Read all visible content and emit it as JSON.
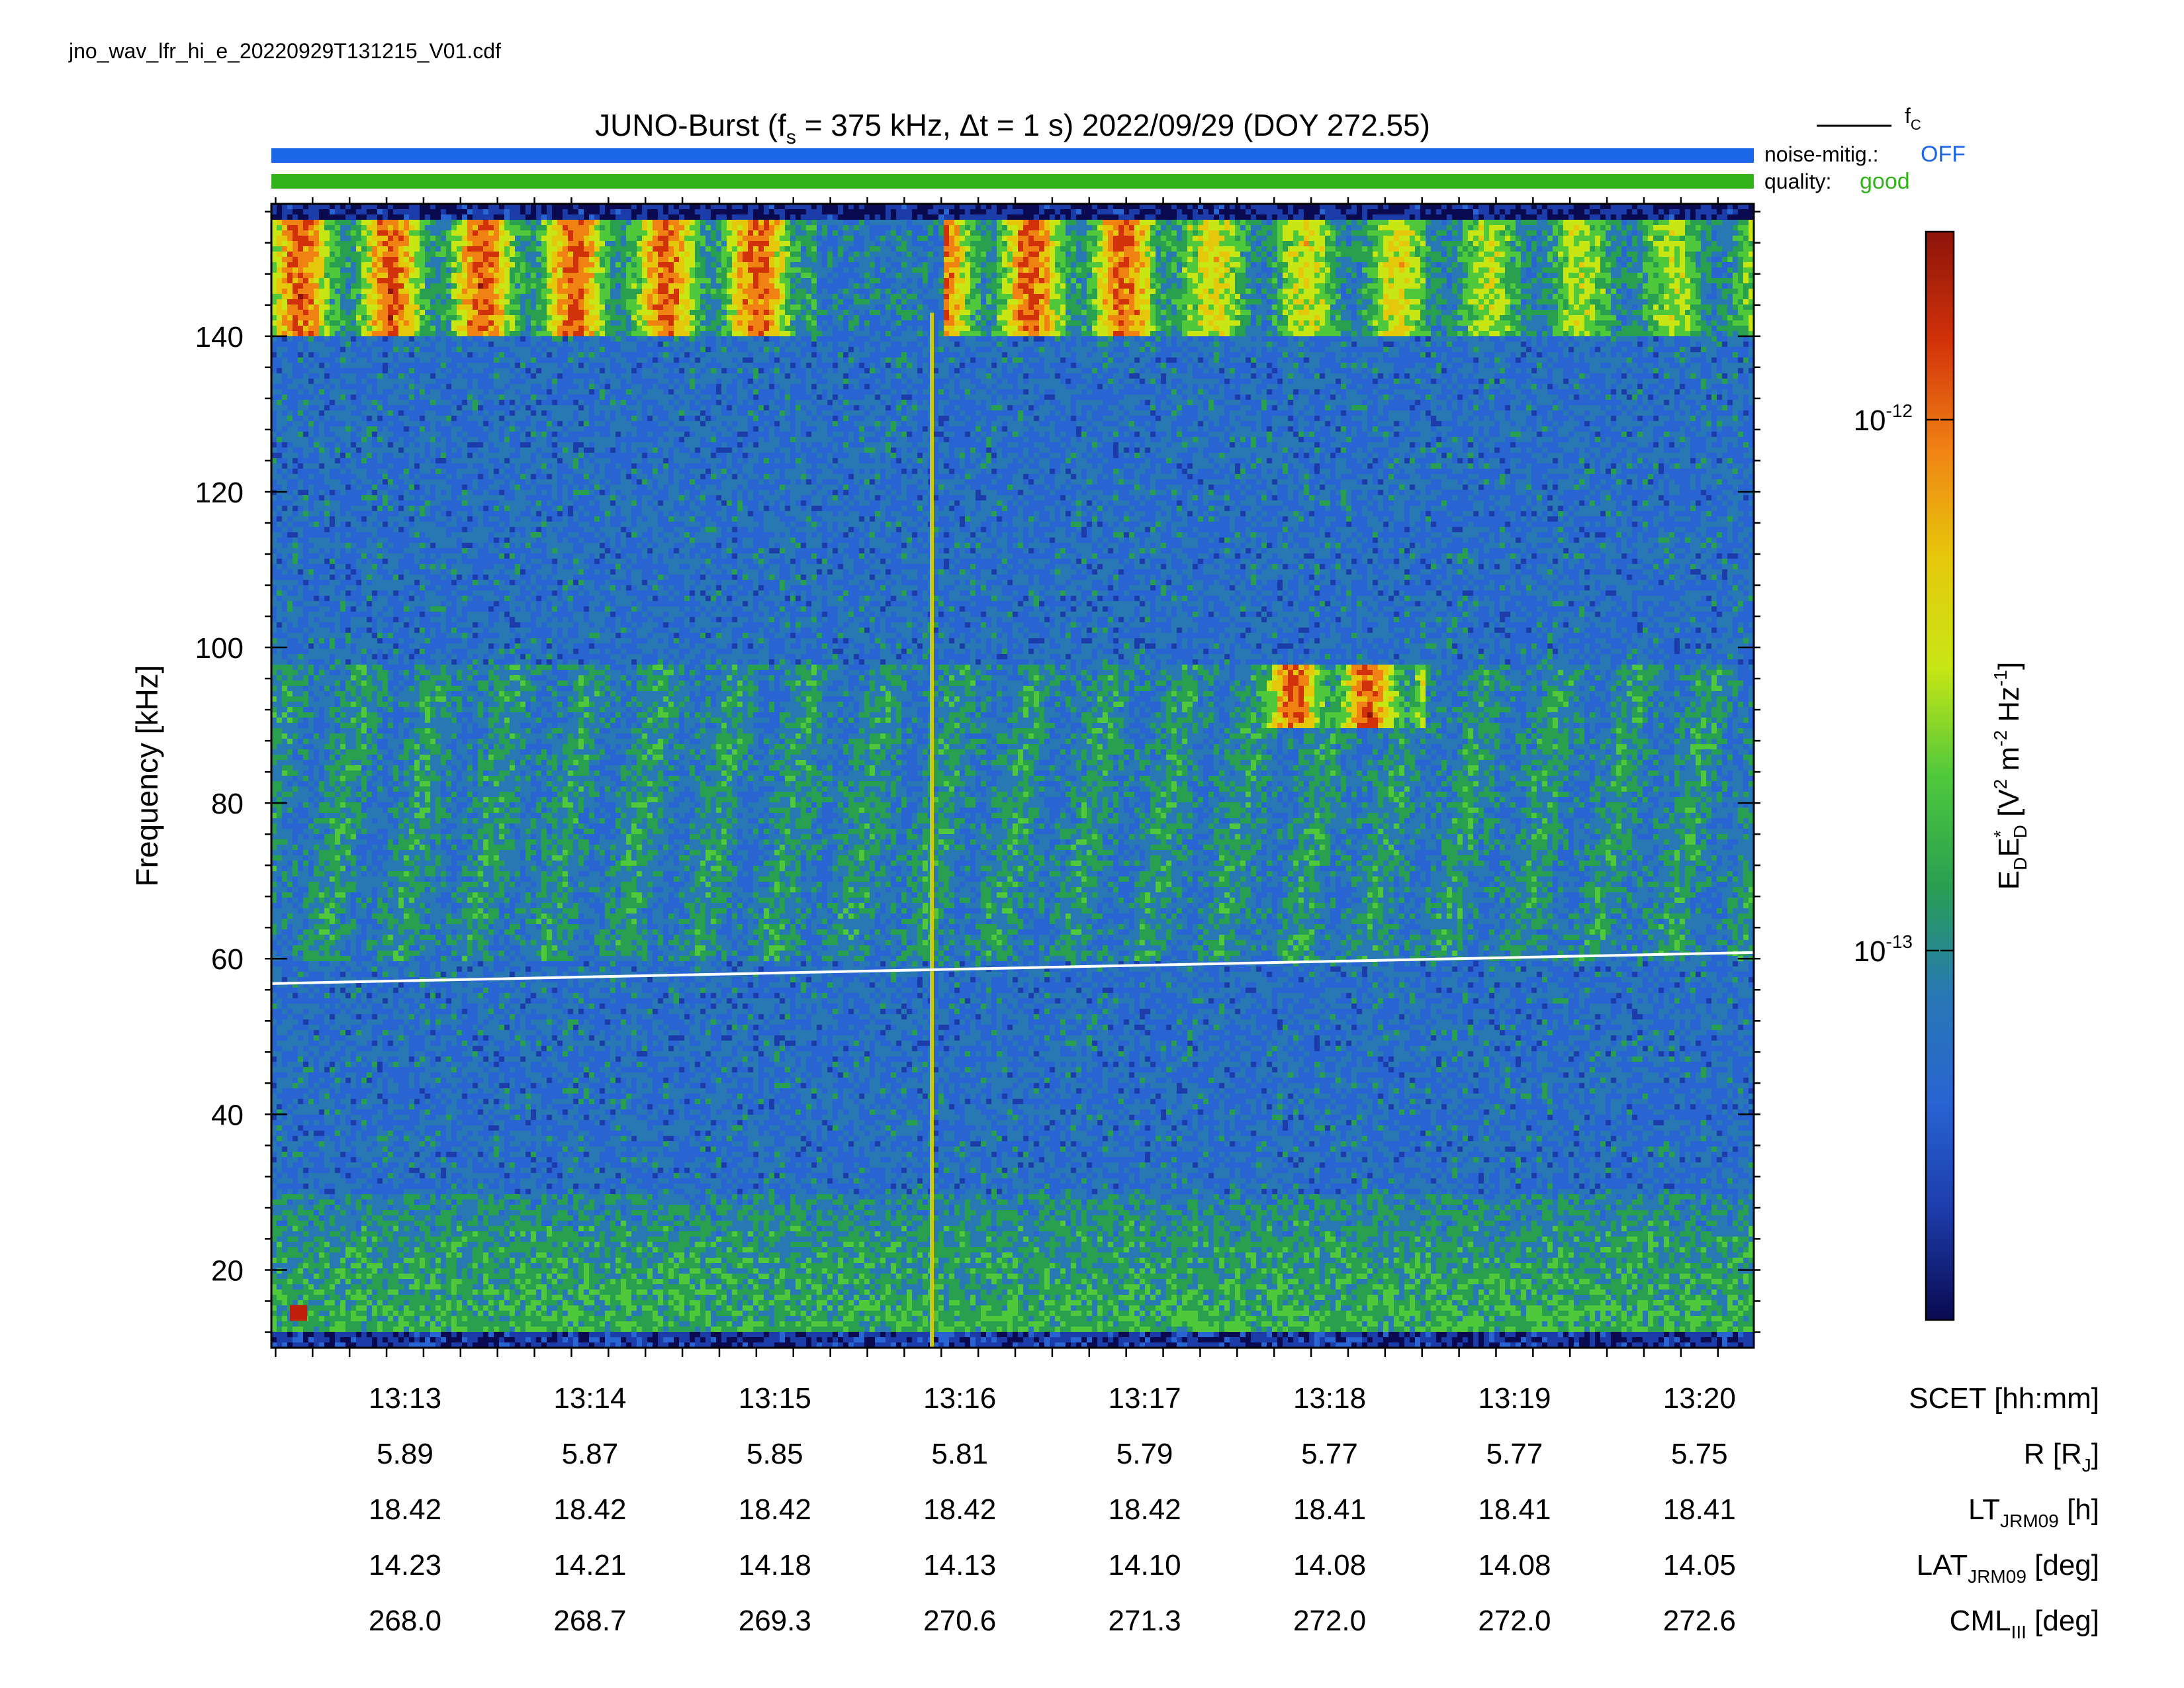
{
  "filename": "jno_wav_lfr_hi_e_20220929T131215_V01.cdf",
  "title": {
    "prefix": "JUNO-Burst (f",
    "fs_sub": "s",
    "mid": " = 375 kHz, Δt = 1 s)  2022/09/29 (DOY 272.55)"
  },
  "legend": {
    "fc_label": "f",
    "fc_sub": "C",
    "noise_label": "noise-mitig.:",
    "noise_value": "OFF",
    "quality_label": "quality:",
    "quality_value": "good",
    "noise_color": "#1a66e6",
    "quality_color": "#33b31a"
  },
  "colorbar": {
    "label_main": "E",
    "label_sub1": "D",
    "label_E2": "E",
    "label_sup": "*",
    "label_sub2": "D",
    "label_units_pre": " [V",
    "label_sup2": "2",
    "label_units_mid": " m",
    "label_sup3": "-2",
    "label_units_hz": " Hz",
    "label_sup4": "-1",
    "label_units_end": "]",
    "tick_base": "10",
    "ticks": [
      {
        "exp": "-12"
      },
      {
        "exp": "-13"
      }
    ],
    "colormap": [
      "#0a0a50",
      "#1c3caa",
      "#2864d2",
      "#2878b4",
      "#28a050",
      "#50c83c",
      "#c8e614",
      "#e6c80a",
      "#f08214",
      "#d2320a",
      "#8c140a"
    ]
  },
  "chart_data": {
    "type": "heatmap",
    "ylabel": "Frequency [kHz]",
    "ylim": [
      10,
      157
    ],
    "yticks": [
      "20",
      "40",
      "60",
      "80",
      "100",
      "120",
      "140"
    ],
    "ytick_values": [
      20,
      40,
      60,
      80,
      100,
      120,
      140
    ],
    "x_rows": [
      {
        "label": "SCET [hh:mm]",
        "values": [
          "13:13",
          "13:14",
          "13:15",
          "13:16",
          "13:17",
          "13:18",
          "13:19",
          "13:20"
        ]
      },
      {
        "label_main": "R [R",
        "label_sub": "J",
        "label_end": "]",
        "values": [
          "5.89",
          "5.87",
          "5.85",
          "5.81",
          "5.79",
          "5.77",
          "5.77",
          "5.75"
        ]
      },
      {
        "label_main": "LT",
        "label_sub": "JRM09",
        "label_end": " [h]",
        "values": [
          "18.42",
          "18.42",
          "18.42",
          "18.42",
          "18.42",
          "18.41",
          "18.41",
          "18.41"
        ]
      },
      {
        "label_main": "LAT",
        "label_sub": "JRM09",
        "label_end": " [deg]",
        "values": [
          "14.23",
          "14.21",
          "14.18",
          "14.13",
          "14.10",
          "14.08",
          "14.08",
          "14.05"
        ]
      },
      {
        "label_main": "CML",
        "label_sub": "III",
        "label_end": " [deg]",
        "values": [
          "268.0",
          "268.7",
          "269.3",
          "270.6",
          "271.3",
          "272.0",
          "272.0",
          "272.6"
        ]
      }
    ],
    "fc_line_khz": [
      56.8,
      60.8
    ],
    "features": [
      {
        "name": "upper band bursts",
        "f_range_khz": [
          140,
          156
        ]
      },
      {
        "name": "mid band emission",
        "f_range_khz": [
          60,
          98
        ]
      },
      {
        "name": "interference spike at ~13:15.9",
        "f_range_khz": [
          10,
          143
        ]
      },
      {
        "name": "low frequency background",
        "f_range_khz": [
          12,
          30
        ]
      }
    ]
  }
}
